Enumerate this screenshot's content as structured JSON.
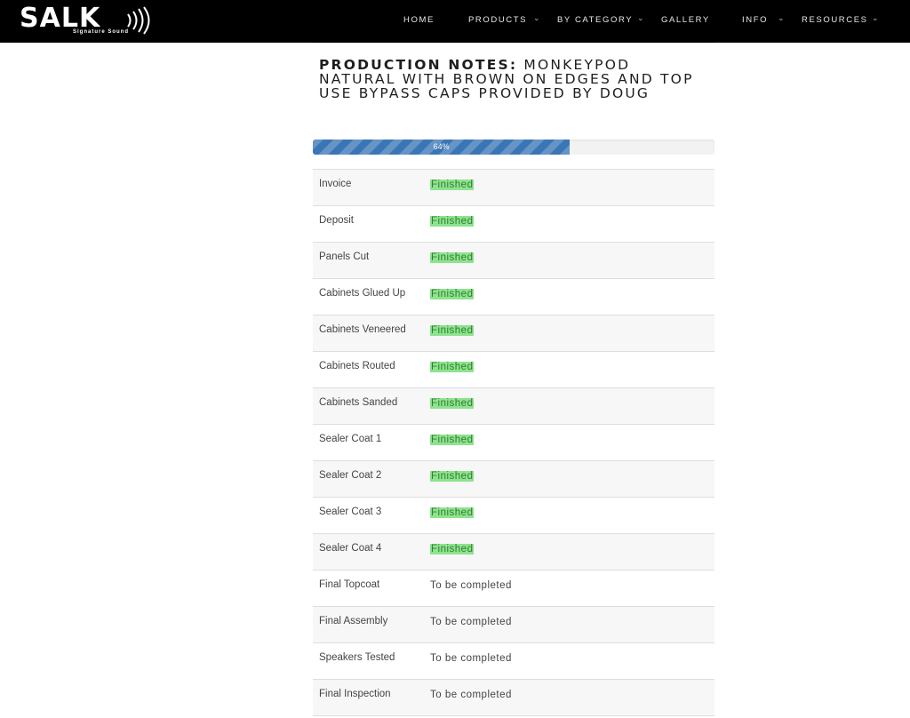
{
  "header": {
    "logo_text": "SALK",
    "logo_tagline": "Signature Sound",
    "nav": [
      {
        "label": "HOME",
        "has_dropdown": false
      },
      {
        "label": "PRODUCTS",
        "has_dropdown": true
      },
      {
        "label": "BY CATEGORY",
        "has_dropdown": true
      },
      {
        "label": "GALLERY",
        "has_dropdown": false
      },
      {
        "label": "INFO",
        "has_dropdown": true
      },
      {
        "label": "RESOURCES",
        "has_dropdown": true
      }
    ],
    "caret_glyph": "⌄"
  },
  "production_notes": {
    "label": "PRODUCTION NOTES:",
    "text": " MONKEYPOD NATURAL WITH BROWN ON EDGES AND TOP USE BYPASS CAPS PROVIDED BY DOUG"
  },
  "progress": {
    "percent": 64,
    "label": "64%"
  },
  "tasks": [
    {
      "name": "Invoice",
      "status": "Finished"
    },
    {
      "name": "Deposit",
      "status": "Finished"
    },
    {
      "name": "Panels Cut",
      "status": "Finished"
    },
    {
      "name": "Cabinets Glued Up",
      "status": "Finished"
    },
    {
      "name": "Cabinets Veneered",
      "status": "Finished"
    },
    {
      "name": "Cabinets Routed",
      "status": "Finished"
    },
    {
      "name": "Cabinets Sanded",
      "status": "Finished"
    },
    {
      "name": "Sealer Coat 1",
      "status": "Finished"
    },
    {
      "name": "Sealer Coat 2",
      "status": "Finished"
    },
    {
      "name": "Sealer Coat 3",
      "status": "Finished"
    },
    {
      "name": "Sealer Coat 4",
      "status": "Finished"
    },
    {
      "name": "Final Topcoat",
      "status": "To be completed"
    },
    {
      "name": "Final Assembly",
      "status": "To be completed"
    },
    {
      "name": "Speakers Tested",
      "status": "To be completed"
    },
    {
      "name": "Final Inspection",
      "status": "To be completed"
    }
  ],
  "colors": {
    "topbar": "#000000",
    "progress_fill": "#3a76b5",
    "finished_highlight": "#8ee38e",
    "finished_text": "#2f7d2f"
  }
}
